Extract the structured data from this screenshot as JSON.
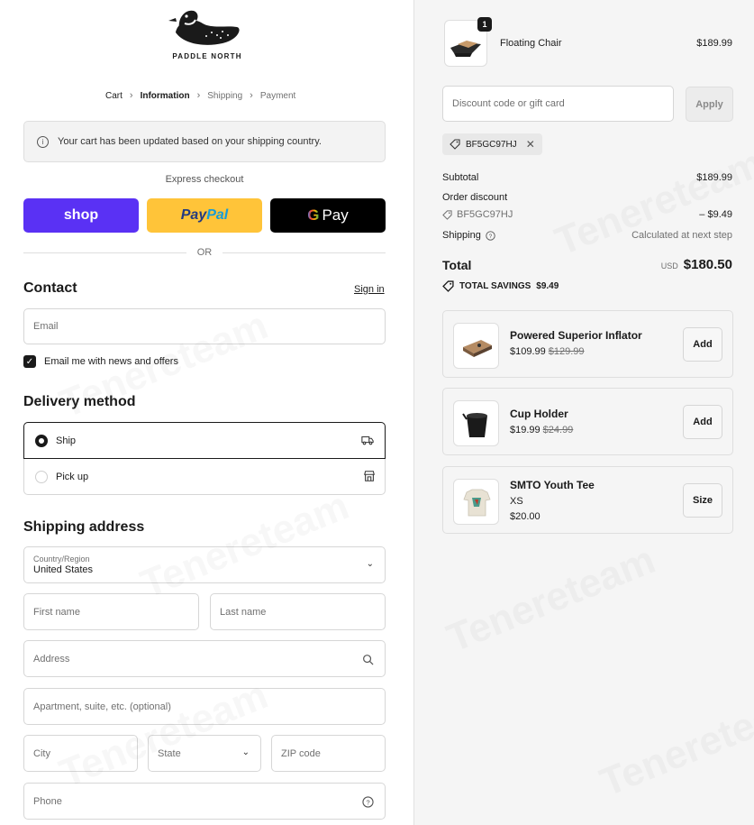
{
  "brand": {
    "name": "PADDLE NORTH"
  },
  "breadcrumb": {
    "cart": "Cart",
    "information": "Information",
    "shipping": "Shipping",
    "payment": "Payment"
  },
  "notice": {
    "text": "Your cart has been updated based on your shipping country."
  },
  "express": {
    "label": "Express checkout",
    "shop_label": "shop",
    "paypal_part1": "Pay",
    "paypal_part2": "Pal",
    "gpay_g": "G",
    "gpay_label": "Pay",
    "or": "OR",
    "colors": {
      "shop": "#5a31f4",
      "paypal": "#ffc439",
      "gpay": "#000000"
    }
  },
  "contact": {
    "title": "Contact",
    "sign_in": "Sign in",
    "email_placeholder": "Email",
    "news_checkbox": "Email me with news and offers",
    "news_checked": true
  },
  "delivery": {
    "title": "Delivery method",
    "options": [
      {
        "label": "Ship",
        "selected": true,
        "icon": "truck-icon"
      },
      {
        "label": "Pick up",
        "selected": false,
        "icon": "store-icon"
      }
    ]
  },
  "shipping_address": {
    "title": "Shipping address",
    "country_label": "Country/Region",
    "country_value": "United States",
    "first_name": "First name",
    "last_name": "Last name",
    "address": "Address",
    "apartment": "Apartment, suite, etc. (optional)",
    "city": "City",
    "state": "State",
    "zip": "ZIP code",
    "phone": "Phone"
  },
  "order": {
    "item": {
      "name": "Floating Chair",
      "price": "$189.99",
      "quantity": "1"
    },
    "discount_placeholder": "Discount code or gift card",
    "apply": "Apply",
    "applied_code": "BF5GC97HJ",
    "subtotal_label": "Subtotal",
    "subtotal_value": "$189.99",
    "order_discount_label": "Order discount",
    "discount_code": "BF5GC97HJ",
    "discount_value": "– $9.49",
    "shipping_label": "Shipping",
    "shipping_value": "Calculated at next step",
    "total_label": "Total",
    "currency": "USD",
    "total_value": "$180.50",
    "savings_label": "TOTAL SAVINGS",
    "savings_value": "$9.49"
  },
  "recommendations": [
    {
      "name": "Powered Superior Inflator",
      "price": "$109.99",
      "compare": "$129.99",
      "variant": "",
      "button": "Add"
    },
    {
      "name": "Cup Holder",
      "price": "$19.99",
      "compare": "$24.99",
      "variant": "",
      "button": "Add"
    },
    {
      "name": "SMTO Youth Tee",
      "price": "$20.00",
      "compare": "",
      "variant": "XS",
      "button": "Size"
    }
  ],
  "watermark": "Tenereteam"
}
